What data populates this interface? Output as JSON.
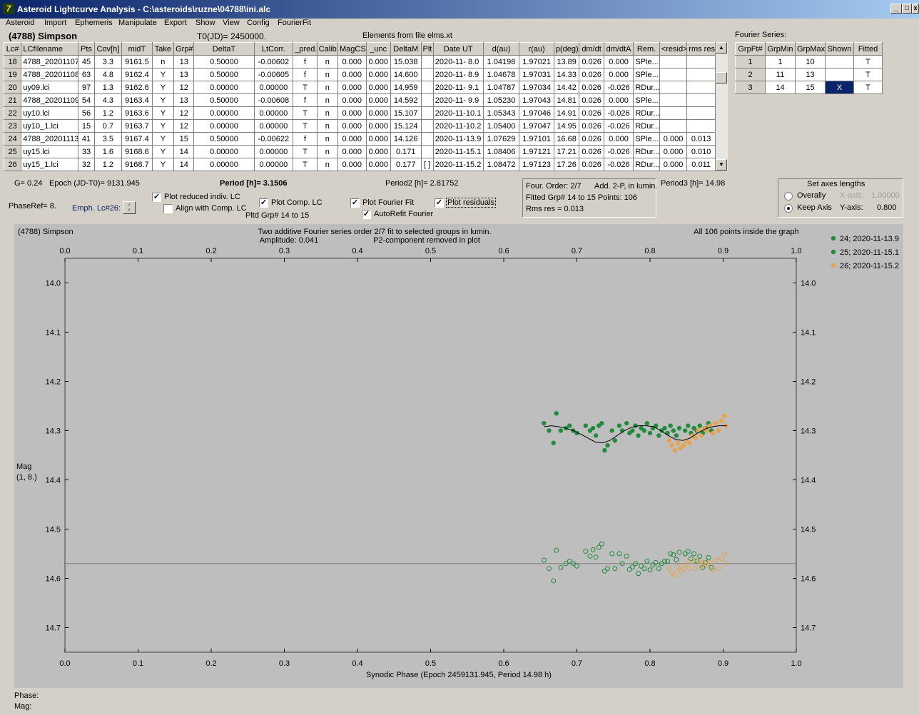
{
  "window": {
    "title": "Asteroid Lightcurve Analysis - C:\\asteroids\\ruzne\\04788\\ini.alc"
  },
  "menu": [
    "Asteroid",
    "Import",
    "Ephemeris",
    "Manipulate",
    "Export",
    "Show",
    "View",
    "Config",
    "FourierFit"
  ],
  "header": {
    "asteroid": "(4788) Simpson",
    "t0": "T0(JD)= 2450000.",
    "elements": "Elements from file elms.xt"
  },
  "table": {
    "columns": [
      "Lc#",
      "LCfilename",
      "Pts",
      "Cov[h]",
      "midT",
      "Take",
      "Grp#",
      "DeltaT",
      "LtCorr.",
      "_pred.",
      "Calib.",
      "MagCS",
      "_unc",
      "DeltaM",
      "Plt",
      "Date UT",
      "d(au)",
      "r(au)",
      "p(deg)",
      "dm/dt",
      "dm/dtA",
      "Rem.",
      "<resid>",
      "rms res"
    ],
    "rows": [
      [
        "18",
        "4788_20201107",
        "45",
        "3.3",
        "9161.5",
        "n",
        "13",
        "0.50000",
        "-0.00602",
        "f",
        "n",
        "0.000",
        "0.000",
        "15.038",
        "",
        "2020-11- 8.0",
        "1.04198",
        "1.97021",
        "13.89",
        "0.026",
        "0.000",
        "SPle...",
        "",
        ""
      ],
      [
        "19",
        "4788_20201108",
        "63",
        "4.8",
        "9162.4",
        "Y",
        "13",
        "0.50000",
        "-0.00605",
        "f",
        "n",
        "0.000",
        "0.000",
        "14.600",
        "",
        "2020-11- 8.9",
        "1.04678",
        "1.97031",
        "14.33",
        "0.026",
        "0.000",
        "SPle...",
        "",
        ""
      ],
      [
        "20",
        "uy09.lci",
        "97",
        "1.3",
        "9162.6",
        "Y",
        "12",
        "0.00000",
        "0.00000",
        "T",
        "n",
        "0.000",
        "0.000",
        "14.959",
        "",
        "2020-11- 9.1",
        "1.04787",
        "1.97034",
        "14.42",
        "0.026",
        "-0.026",
        "RDur...",
        "",
        ""
      ],
      [
        "21",
        "4788_20201109",
        "54",
        "4.3",
        "9163.4",
        "Y",
        "13",
        "0.50000",
        "-0.00608",
        "f",
        "n",
        "0.000",
        "0.000",
        "14.592",
        "",
        "2020-11- 9.9",
        "1.05230",
        "1.97043",
        "14.81",
        "0.026",
        "0.000",
        "SPle...",
        "",
        ""
      ],
      [
        "22",
        "uy10.lci",
        "56",
        "1.2",
        "9163.6",
        "Y",
        "12",
        "0.00000",
        "0.00000",
        "T",
        "n",
        "0.000",
        "0.000",
        "15.107",
        "",
        "2020-11-10.1",
        "1.05343",
        "1.97046",
        "14.91",
        "0.026",
        "-0.026",
        "RDur...",
        "",
        ""
      ],
      [
        "23",
        "uy10_1.lci",
        "15",
        "0.7",
        "9163.7",
        "Y",
        "12",
        "0.00000",
        "0.00000",
        "T",
        "n",
        "0.000",
        "0.000",
        "15.124",
        "",
        "2020-11-10.2",
        "1.05400",
        "1.97047",
        "14.95",
        "0.026",
        "-0.026",
        "RDur...",
        "",
        ""
      ],
      [
        "24",
        "4788_20201113",
        "41",
        "3.5",
        "9167.4",
        "Y",
        "15",
        "0.50000",
        "-0.00622",
        "f",
        "n",
        "0.000",
        "0.000",
        "14.126",
        "",
        "2020-11-13.9",
        "1.07629",
        "1.97101",
        "16.68",
        "0.026",
        "0.000",
        "SPle...",
        "0.000",
        "0.013"
      ],
      [
        "25",
        "uy15.lci",
        "33",
        "1.6",
        "9168.6",
        "Y",
        "14",
        "0.00000",
        "0.00000",
        "T",
        "n",
        "0.000",
        "0.000",
        "0.171",
        "",
        "2020-11-15.1",
        "1.08406",
        "1.97121",
        "17.21",
        "0.026",
        "-0.026",
        "RDur...",
        "0.000",
        "0.010"
      ],
      [
        "26",
        "uy15_1.lci",
        "32",
        "1.2",
        "9168.7",
        "Y",
        "14",
        "0.00000",
        "0.00000",
        "T",
        "n",
        "0.000",
        "0.000",
        "0.177",
        "[ ]",
        "2020-11-15.2",
        "1.08472",
        "1.97123",
        "17.26",
        "0.026",
        "-0.026",
        "RDur...",
        "0.000",
        "0.011"
      ]
    ]
  },
  "fourier_series": {
    "label": "Fourier Series:",
    "columns": [
      "GrpFt#",
      "GrpMin",
      "GrpMax",
      "Shown",
      "Fitted"
    ],
    "rows": [
      [
        "1",
        "1",
        "10",
        "",
        "T"
      ],
      [
        "2",
        "11",
        "13",
        "",
        "T"
      ],
      [
        "3",
        "14",
        "15",
        "X",
        "T"
      ]
    ]
  },
  "params": {
    "g": "G= 0.24",
    "epoch": "Epoch (JD-T0)= 9131.945",
    "period": "Period [h]= 3.1506",
    "period2": "Period2 [h]= 2.81752",
    "period3": "Period3 [h]= 14.98",
    "phaseref": "PhaseRef= 8.",
    "emph": "Emph. Lc#26:",
    "pltd_grp": "Pltd Grp#  14 to   15"
  },
  "checkboxes": {
    "reduced": {
      "label": "Plot reduced indiv. LC",
      "checked": "✓"
    },
    "align": {
      "label": "Align with Comp. LC",
      "checked": ""
    },
    "comp": {
      "label": "Plot Comp. LC",
      "checked": "✓"
    },
    "fourier": {
      "label": "Plot Fourier Fit",
      "checked": "✓"
    },
    "autorefit": {
      "label": "AutoRefit Fourier",
      "checked": "✓"
    },
    "residuals": {
      "label": "Plot residuals",
      "checked": "✓"
    }
  },
  "fit_info": {
    "order": "Four. Order:  2/7",
    "add": "Add. 2-P, in lumin.",
    "fitted": "Fitted Grp# 14 to 15 Points: 106",
    "rms": "Rms res     = 0.013"
  },
  "axes": {
    "title": "Set axes lengths",
    "overally": "Overally",
    "keep": "Keep Axis",
    "xaxis_label": "X-axis:",
    "xaxis_value": "1.00000",
    "yaxis_label": "Y-axis:",
    "yaxis_value": "0.800"
  },
  "status": {
    "phase": "Phase:",
    "mag": "Mag:"
  },
  "colors": {
    "green": "#1e8c3a",
    "orange": "#e8a24a",
    "plot_bg": "#bebebe",
    "titlebar": "#0a246a"
  },
  "chart_data": {
    "type": "scatter",
    "title_left": "(4788) Simpson",
    "title_center": "Two additive Fourier series order 2/7 fit to selected groups in lumin.",
    "amplitude": "Amplitude: 0.041",
    "p2_note": "P2-component removed in plot",
    "points_note": "All 106 points inside the graph",
    "xlabel": "Synodic Phase (Epoch 2459131.945, Period 14.98 h)",
    "ylabel": "Mag",
    "ylabel2": "(1, 8.)",
    "xlim": [
      0,
      1
    ],
    "ylim": [
      14.75,
      13.95
    ],
    "x_ticks": [
      "0.0",
      "0.1",
      "0.2",
      "0.3",
      "0.4",
      "0.5",
      "0.6",
      "0.7",
      "0.8",
      "0.9",
      "1.0"
    ],
    "y_ticks": [
      "14.0",
      "14.1",
      "14.2",
      "14.3",
      "14.4",
      "14.5",
      "14.6",
      "14.7"
    ],
    "residual_line": 14.57,
    "legend": [
      {
        "name": "24; 2020-11-13.9",
        "color": "#1e8c3a"
      },
      {
        "name": "25; 2020-11-15.1",
        "color": "#1e8c3a"
      },
      {
        "name": "26; 2020-11-15.2",
        "color": "#e8a24a"
      }
    ],
    "series": [
      {
        "name": "24; 2020-11-13.9",
        "color": "#1e8c3a",
        "x": [
          0.655,
          0.662,
          0.668,
          0.672,
          0.678,
          0.685,
          0.69,
          0.695,
          0.7,
          0.712,
          0.718,
          0.722,
          0.726,
          0.73,
          0.734,
          0.738,
          0.742,
          0.748,
          0.752,
          0.758,
          0.762,
          0.768,
          0.772
        ],
        "y": [
          14.285,
          14.3,
          14.325,
          14.265,
          14.3,
          14.295,
          14.29,
          14.3,
          14.305,
          14.29,
          14.3,
          14.295,
          14.31,
          14.29,
          14.285,
          14.34,
          14.33,
          14.3,
          14.32,
          14.29,
          14.3,
          14.285,
          14.305
        ]
      },
      {
        "name": "25; 2020-11-15.1",
        "color": "#1e8c3a",
        "x": [
          0.776,
          0.78,
          0.784,
          0.788,
          0.792,
          0.796,
          0.8,
          0.804,
          0.808,
          0.812,
          0.816,
          0.82,
          0.824,
          0.828,
          0.832,
          0.836,
          0.84,
          0.848,
          0.852,
          0.856,
          0.86,
          0.864,
          0.868,
          0.872,
          0.876,
          0.88,
          0.884
        ],
        "y": [
          14.3,
          14.29,
          14.31,
          14.295,
          14.3,
          14.285,
          14.305,
          14.295,
          14.29,
          14.31,
          14.3,
          14.295,
          14.305,
          14.29,
          14.3,
          14.31,
          14.295,
          14.3,
          14.29,
          14.305,
          14.295,
          14.3,
          14.29,
          14.305,
          14.295,
          14.285,
          14.3
        ]
      },
      {
        "name": "26; 2020-11-15.2",
        "color": "#e8a24a",
        "x": [
          0.826,
          0.83,
          0.834,
          0.838,
          0.842,
          0.846,
          0.85,
          0.854,
          0.858,
          0.862,
          0.866,
          0.87,
          0.874,
          0.878,
          0.882,
          0.886,
          0.89,
          0.894,
          0.898,
          0.902,
          0.904
        ],
        "y": [
          14.32,
          14.33,
          14.34,
          14.325,
          14.335,
          14.33,
          14.32,
          14.325,
          14.31,
          14.315,
          14.3,
          14.31,
          14.295,
          14.3,
          14.29,
          14.305,
          14.285,
          14.3,
          14.28,
          14.27,
          14.29
        ]
      }
    ],
    "fit": {
      "x": [
        0.655,
        0.665,
        0.675,
        0.685,
        0.695,
        0.705,
        0.715,
        0.725,
        0.735,
        0.745,
        0.755,
        0.765,
        0.775,
        0.785,
        0.795,
        0.805,
        0.815,
        0.825,
        0.835,
        0.845,
        0.855,
        0.865,
        0.875,
        0.885,
        0.895,
        0.905
      ],
      "y": [
        14.292,
        14.29,
        14.292,
        14.295,
        14.3,
        14.307,
        14.315,
        14.323,
        14.325,
        14.32,
        14.31,
        14.3,
        14.293,
        14.29,
        14.29,
        14.292,
        14.3,
        14.31,
        14.318,
        14.32,
        14.315,
        14.305,
        14.297,
        14.292,
        14.29,
        14.29
      ]
    }
  }
}
